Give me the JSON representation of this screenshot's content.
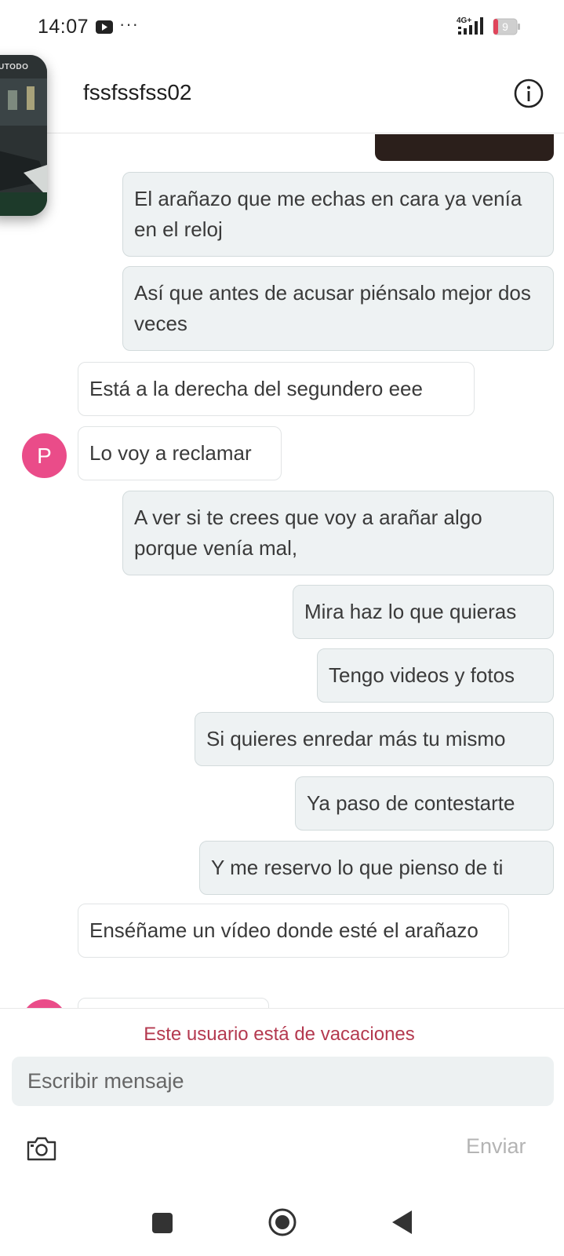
{
  "status_bar": {
    "time": "14:07",
    "network": "4G+",
    "battery_level": "9",
    "youtube_icon": "youtube-icon",
    "more_icon": "more-dots-icon"
  },
  "header": {
    "title": "fssfssfss02",
    "info_icon": "info-icon"
  },
  "pip_overlay": {
    "label": "UTODO"
  },
  "messages": [
    {
      "direction": "out",
      "text": "El arañazo que me echas en cara ya venía en el reloj"
    },
    {
      "direction": "out",
      "text": "Así que antes de acusar piénsalo mejor dos veces"
    },
    {
      "direction": "in",
      "text": "Está a la derecha del segundero eee"
    },
    {
      "direction": "in",
      "text": "Lo voy a reclamar",
      "avatar": "P"
    },
    {
      "direction": "out",
      "text": "A ver si te crees que voy a arañar algo porque venía mal,"
    },
    {
      "direction": "out",
      "text": "Mira haz lo que quieras"
    },
    {
      "direction": "out",
      "text": "Tengo videos y fotos"
    },
    {
      "direction": "out",
      "text": "Si quieres enredar más tu mismo"
    },
    {
      "direction": "out",
      "text": "Ya paso de contestarte"
    },
    {
      "direction": "out",
      "text": "Y me reservo lo que pienso de ti"
    },
    {
      "direction": "in",
      "text": "Enséñame un vídeo donde esté el arañazo"
    }
  ],
  "composer": {
    "vacation_notice": "Este usuario está de vacaciones",
    "input_placeholder": "Escribir mensaje",
    "send_label": "Enviar",
    "camera_icon": "camera-icon"
  },
  "colors": {
    "avatar": "#ea4c89",
    "outgoing_bubble": "#eef2f3",
    "vacation_text": "#b4394f",
    "send_disabled": "#b4b4b4"
  }
}
